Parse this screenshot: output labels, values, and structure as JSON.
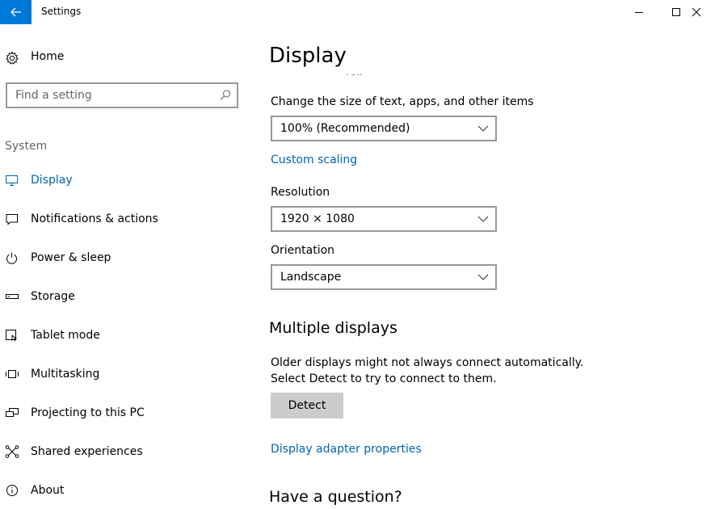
{
  "window": {
    "title": "Settings"
  },
  "sidebar": {
    "home_label": "Home",
    "search_placeholder": "Find a setting",
    "section_label": "System",
    "items": [
      {
        "label": "Display",
        "icon": "monitor-icon",
        "active": true
      },
      {
        "label": "Notifications & actions",
        "icon": "notification-icon"
      },
      {
        "label": "Power & sleep",
        "icon": "power-icon"
      },
      {
        "label": "Storage",
        "icon": "storage-icon"
      },
      {
        "label": "Tablet mode",
        "icon": "tablet-mode-icon"
      },
      {
        "label": "Multitasking",
        "icon": "multitasking-icon"
      },
      {
        "label": "Projecting to this PC",
        "icon": "projecting-icon"
      },
      {
        "label": "Shared experiences",
        "icon": "shared-experiences-icon"
      },
      {
        "label": "About",
        "icon": "info-icon"
      }
    ]
  },
  "main": {
    "title": "Display",
    "scale": {
      "label": "Change the size of text, apps, and other items",
      "value": "100% (Recommended)",
      "custom_link": "Custom scaling"
    },
    "resolution": {
      "label": "Resolution",
      "value": "1920 × 1080"
    },
    "orientation": {
      "label": "Orientation",
      "value": "Landscape"
    },
    "multiple_displays": {
      "heading": "Multiple displays",
      "description": "Older displays might not always connect automatically. Select Detect to try to connect to them.",
      "detect_button": "Detect",
      "adapter_link": "Display adapter properties"
    },
    "question_heading": "Have a question?"
  },
  "colors": {
    "accent": "#0078d7",
    "link": "#0063b1",
    "button_bg": "#cccccc"
  }
}
